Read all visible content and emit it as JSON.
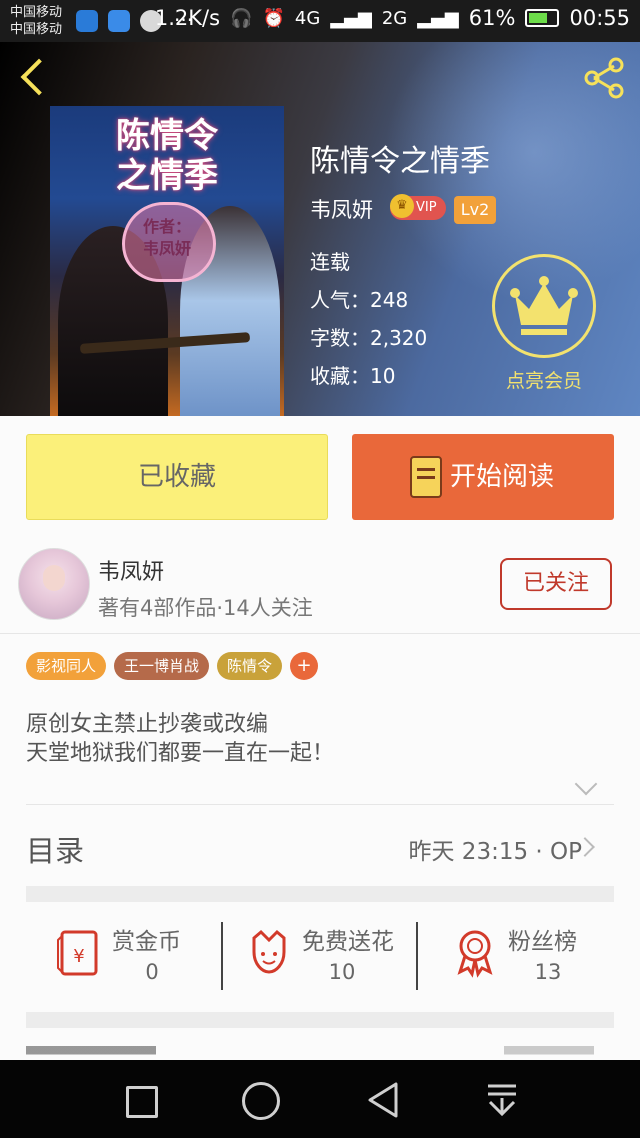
{
  "status_bar": {
    "carrier1": "中国移动",
    "carrier2": "中国移动",
    "dots": "···",
    "speed": "1.2K/s",
    "net1": "4G",
    "net2": "2G",
    "battery": "61%",
    "time": "00:55"
  },
  "header": {
    "cover": {
      "title_line1": "陈情令",
      "title_line2": "之情季",
      "author_line1": "作者：",
      "author_line2": "韦凤妍"
    },
    "title": "陈情令之情季",
    "author": "韦凤妍",
    "vip_label": "VIP",
    "level": "Lv2",
    "status": "连载",
    "popularity": "人气：248",
    "word_count": "字数：2,320",
    "favorites": "收藏：10",
    "member_label": "点亮会员",
    "accent_color": "#f3e26e"
  },
  "actions": {
    "collected": "已收藏",
    "start_reading": "开始阅读"
  },
  "author_row": {
    "name": "韦凤妍",
    "meta": "著有4部作品·14人关注",
    "follow": "已关注"
  },
  "tags": [
    "影视同人",
    "王一博肖战",
    "陈情令"
  ],
  "tag_add": "+",
  "description": {
    "line1": "原创女主禁止抄袭或改编",
    "line2": "天堂地狱我们都要一直在一起！"
  },
  "toc": {
    "label": "目录",
    "update": "昨天 23:15 · OP"
  },
  "stats": [
    {
      "label": "赏金币",
      "value": "0",
      "icon": "red-envelope-icon"
    },
    {
      "label": "免费送花",
      "value": "10",
      "icon": "flower-icon"
    },
    {
      "label": "粉丝榜",
      "value": "13",
      "icon": "award-ribbon-icon"
    }
  ],
  "colors": {
    "primary_orange": "#e9683a",
    "collected_yellow": "#fbf07a",
    "follow_red": "#c0392b"
  }
}
